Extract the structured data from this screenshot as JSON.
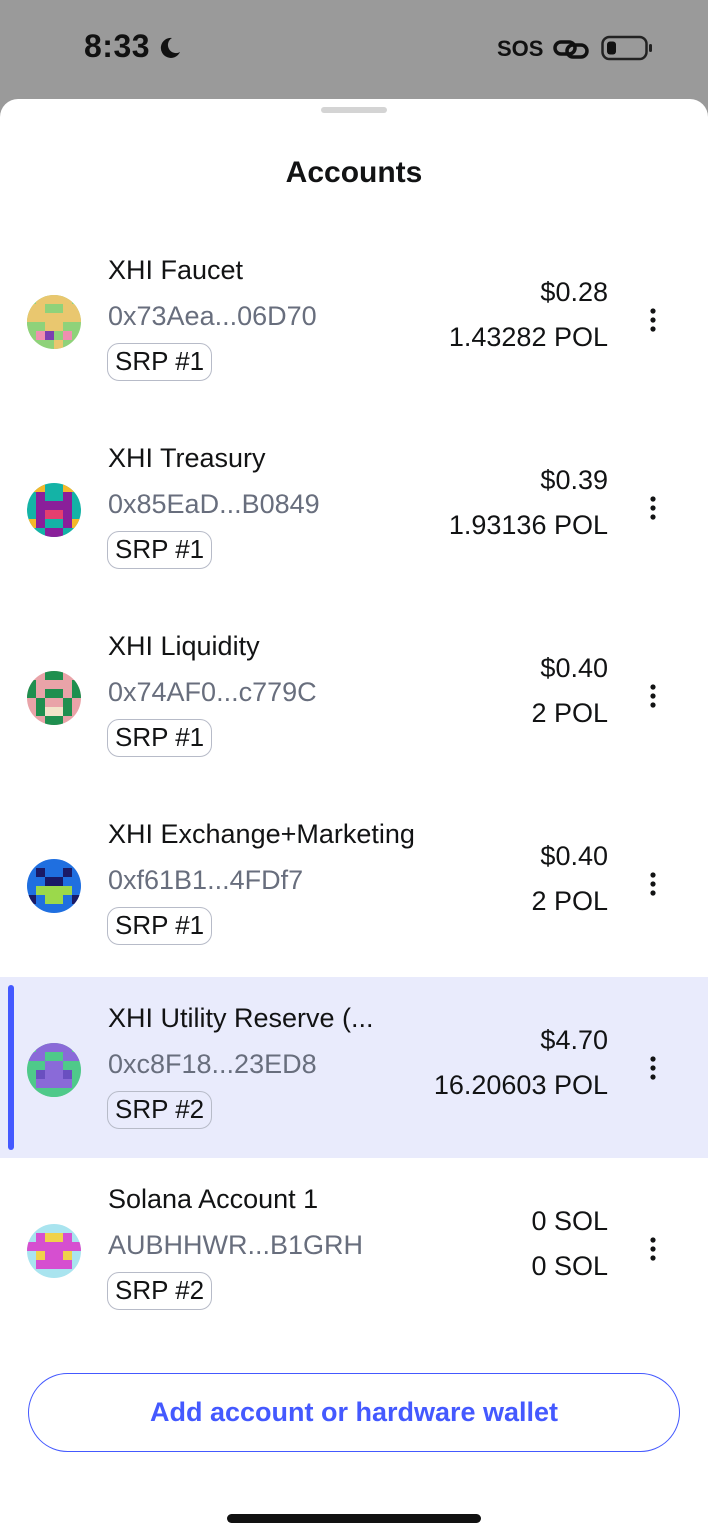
{
  "status_bar": {
    "time": "8:33",
    "sos": "SOS",
    "icons": [
      "moon-icon",
      "link-icon",
      "battery-icon"
    ]
  },
  "sheet": {
    "title": "Accounts"
  },
  "accounts": [
    {
      "name": "XHI Faucet",
      "address": "0x73Aea...06D70",
      "srp": "SRP #1",
      "fiat": "$0.28",
      "token": "1.43282 POL",
      "selected": false
    },
    {
      "name": "XHI Treasury",
      "address": "0x85EaD...B0849",
      "srp": "SRP #1",
      "fiat": "$0.39",
      "token": "1.93136 POL",
      "selected": false
    },
    {
      "name": "XHI Liquidity",
      "address": "0x74AF0...c779C",
      "srp": "SRP #1",
      "fiat": "$0.40",
      "token": "2 POL",
      "selected": false
    },
    {
      "name": "XHI Exchange+Marketing",
      "address": "0xf61B1...4FDf7",
      "srp": "SRP #1",
      "fiat": "$0.40",
      "token": "2 POL",
      "selected": false
    },
    {
      "name": "XHI Utility Reserve (...",
      "address": "0xc8F18...23ED8",
      "srp": "SRP #2",
      "fiat": "$4.70",
      "token": "16.20603 POL",
      "selected": true
    },
    {
      "name": "Solana Account 1",
      "address": "AUBHHWR...B1GRH",
      "srp": "SRP #2",
      "fiat": "0 SOL",
      "token": "0 SOL",
      "selected": false
    }
  ],
  "add_button": {
    "label": "Add account or hardware wallet"
  },
  "colors": {
    "accent": "#4459ff",
    "selected_bg": "#e9ebfc",
    "muted_text": "#686e7d",
    "status_bar_bg": "#9a9a9a"
  }
}
